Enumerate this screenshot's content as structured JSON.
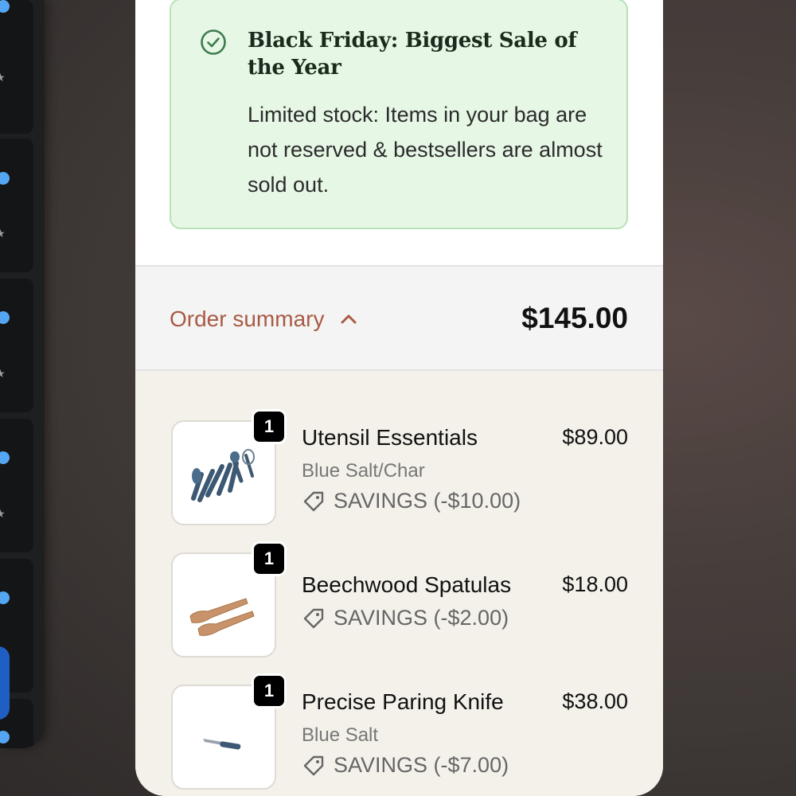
{
  "banner": {
    "title": "Black Friday: Biggest Sale of the Year",
    "body": "Limited stock: Items in your bag are not reserved & bestsellers are almost sold out.",
    "icon": "check-circle-icon",
    "color": "#e6f7e5"
  },
  "order_summary": {
    "label": "Order summary",
    "toggle_icon": "chevron-up-icon",
    "total": "$145.00",
    "label_color": "#a85a43"
  },
  "items": [
    {
      "quantity": "1",
      "name": "Utensil Essentials",
      "variant": "Blue Salt/Char",
      "savings": "SAVINGS (-$10.00)",
      "price": "$89.00",
      "image": "utensil-set-image"
    },
    {
      "quantity": "1",
      "name": "Beechwood Spatulas",
      "savings": "SAVINGS (-$2.00)",
      "price": "$18.00",
      "image": "spatulas-image"
    },
    {
      "quantity": "1",
      "name": "Precise Paring Knife",
      "variant": "Blue Salt",
      "savings": "SAVINGS (-$7.00)",
      "price": "$38.00",
      "image": "paring-knife-image"
    }
  ]
}
